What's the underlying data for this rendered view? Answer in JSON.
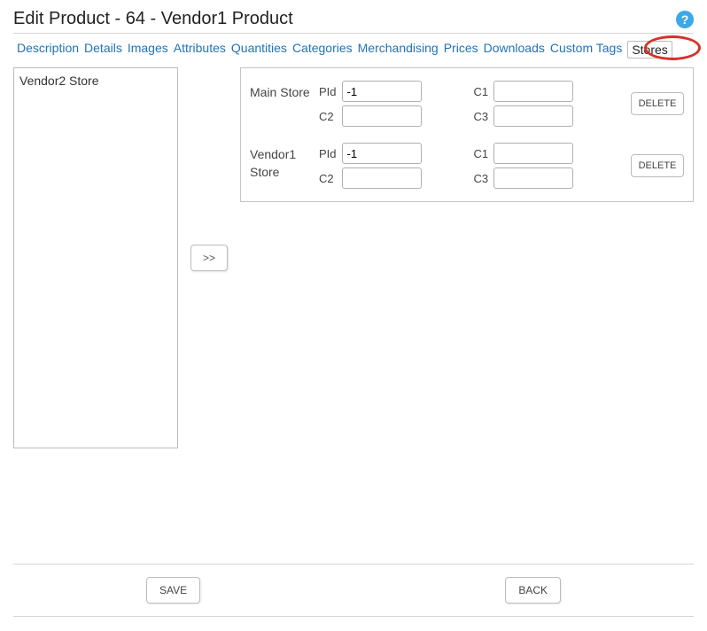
{
  "header": {
    "title": "Edit Product - 64 - Vendor1 Product",
    "help": "?"
  },
  "tabs": [
    "Description",
    "Details",
    "Images",
    "Attributes",
    "Quantities",
    "Categories",
    "Merchandising",
    "Prices",
    "Downloads",
    "Custom Tags",
    "Stores"
  ],
  "activeTab": "Stores",
  "availableStores": {
    "items": [
      "Vendor2 Store"
    ]
  },
  "transfer": {
    "addLabel": ">>"
  },
  "assignedStores": [
    {
      "name": "Main Store",
      "labels": {
        "pid": "PId",
        "c1": "C1",
        "c2": "C2",
        "c3": "C3"
      },
      "values": {
        "pid": "-1",
        "c1": "",
        "c2": "",
        "c3": ""
      },
      "deleteLabel": "DELETE"
    },
    {
      "name": "Vendor1 Store",
      "labels": {
        "pid": "PId",
        "c1": "C1",
        "c2": "C2",
        "c3": "C3"
      },
      "values": {
        "pid": "-1",
        "c1": "",
        "c2": "",
        "c3": ""
      },
      "deleteLabel": "DELETE"
    }
  ],
  "footer": {
    "save": "SAVE",
    "back": "BACK"
  }
}
